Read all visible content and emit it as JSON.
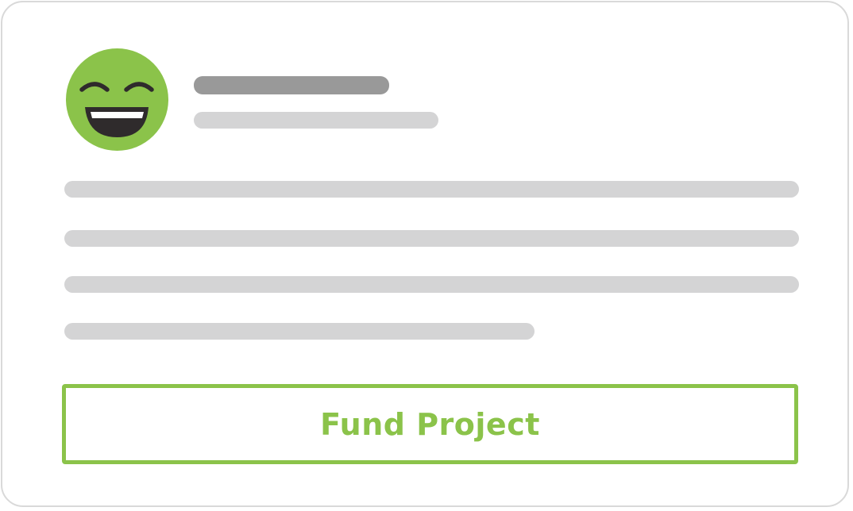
{
  "colors": {
    "accent": "#8bc34a",
    "avatar_face": "#8bc34a",
    "avatar_features": "#2f2b2c",
    "title_placeholder": "#999999",
    "text_placeholder": "#d4d4d5",
    "card_border": "#d9d9d9"
  },
  "avatar": {
    "icon": "laughing-face-icon"
  },
  "card": {
    "title_placeholder": "",
    "subtitle_placeholder": "",
    "body_lines": [
      "",
      "",
      "",
      ""
    ]
  },
  "actions": {
    "fund_label": "Fund Project"
  }
}
